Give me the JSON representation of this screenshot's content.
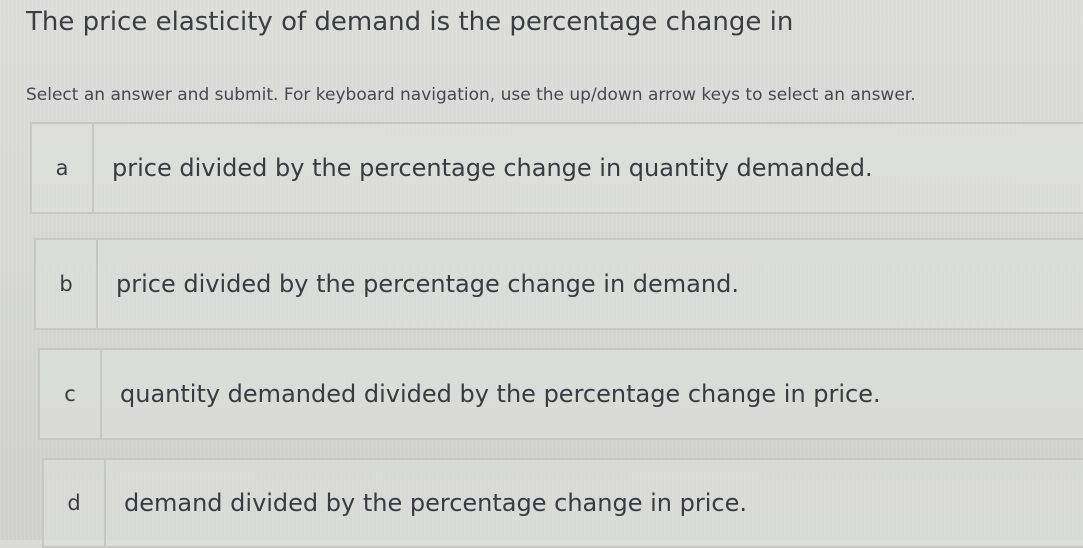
{
  "question": {
    "text": "The price elasticity of demand is the percentage change in"
  },
  "instructions": {
    "text": "Select an answer and submit. For keyboard navigation, use the up/down arrow keys to select an answer."
  },
  "options": [
    {
      "letter": "a",
      "text": "price divided by the percentage change in quantity demanded."
    },
    {
      "letter": "b",
      "text": "price divided by the percentage change in demand."
    },
    {
      "letter": "c",
      "text": "quantity demanded divided by the percentage change in price."
    },
    {
      "letter": "d",
      "text": "demand divided by the percentage change in price."
    }
  ]
}
